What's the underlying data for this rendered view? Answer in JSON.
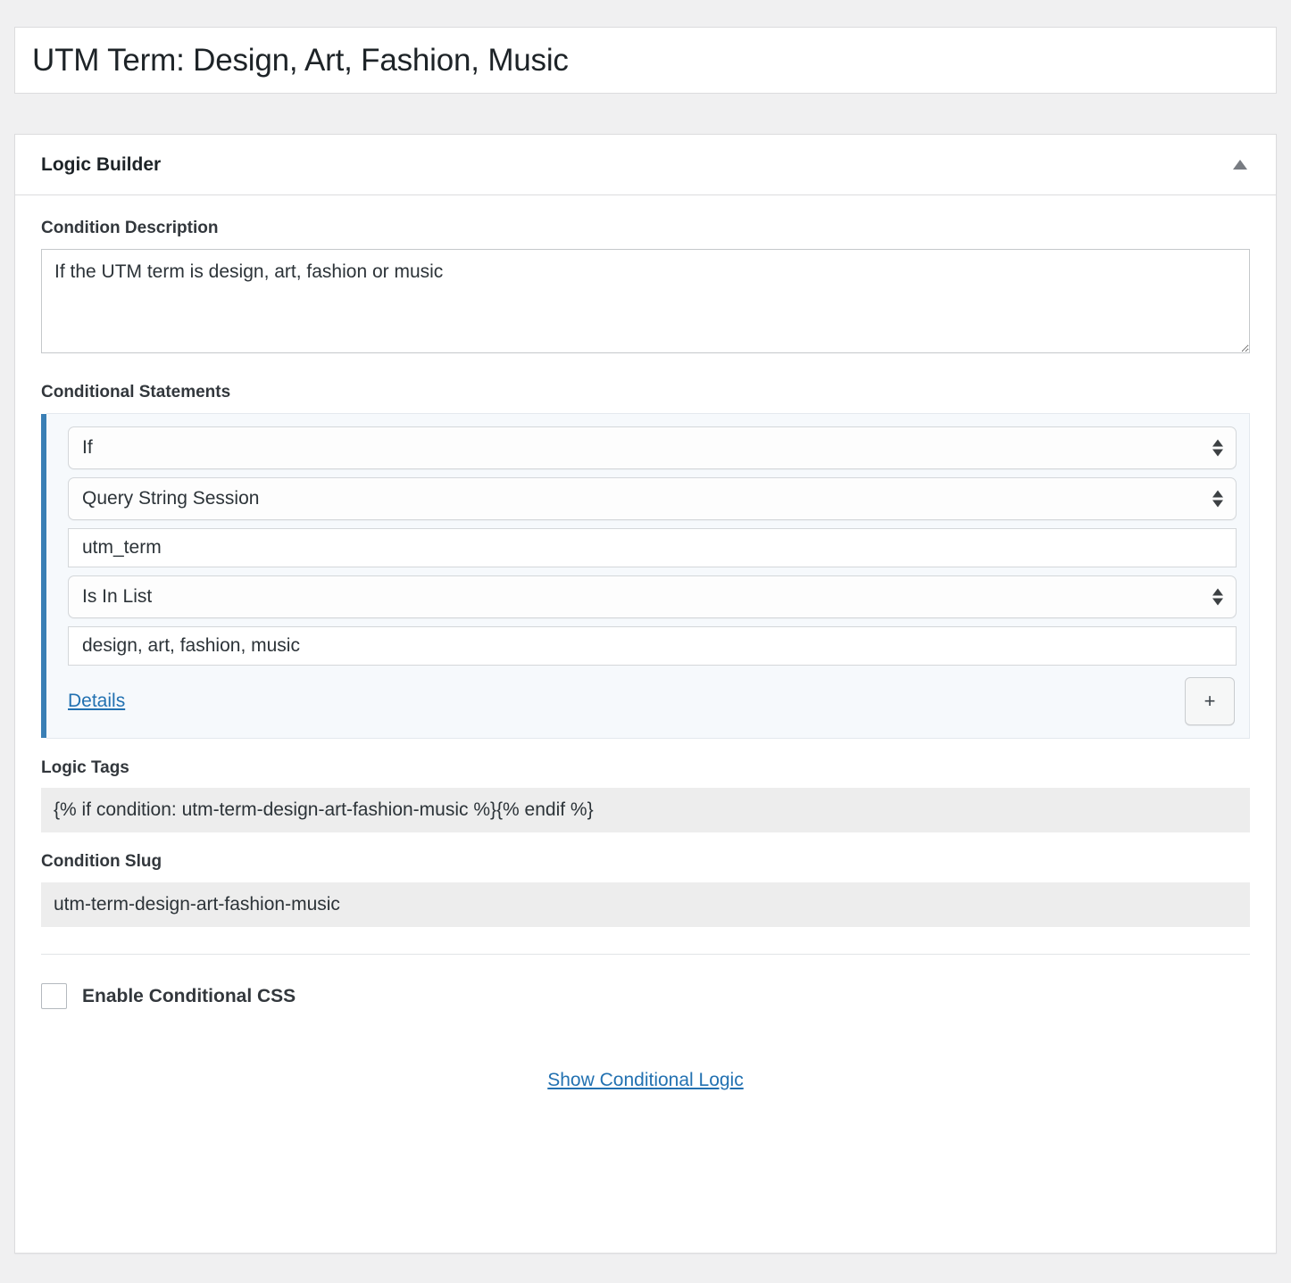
{
  "page": {
    "title": "UTM Term: Design, Art, Fashion, Music"
  },
  "panel": {
    "header_title": "Logic Builder",
    "toggle_icon": "triangle-up-icon"
  },
  "condition_description": {
    "label": "Condition Description",
    "value": "If the UTM term is design, art, fashion or music",
    "placeholder": ""
  },
  "conditional_statements": {
    "label": "Conditional Statements",
    "accent_color": "#3a7fb5",
    "rows": [
      {
        "type": "select",
        "name": "conjunction",
        "value": "If"
      },
      {
        "type": "select",
        "name": "source",
        "value": "Query String Session"
      },
      {
        "type": "input",
        "name": "parameter",
        "value": "utm_term"
      },
      {
        "type": "select",
        "name": "operator",
        "value": "Is In List"
      },
      {
        "type": "input",
        "name": "comparison-value",
        "value": "design, art, fashion, music"
      }
    ],
    "details_link": "Details",
    "add_button": "+"
  },
  "logic_tags": {
    "label": "Logic Tags",
    "value": "{% if condition: utm-term-design-art-fashion-music %}{% endif %}"
  },
  "condition_slug": {
    "label": "Condition Slug",
    "value": "utm-term-design-art-fashion-music"
  },
  "conditional_css": {
    "label": "Enable Conditional CSS",
    "checked": false
  },
  "footer": {
    "link": "Show Conditional Logic"
  }
}
